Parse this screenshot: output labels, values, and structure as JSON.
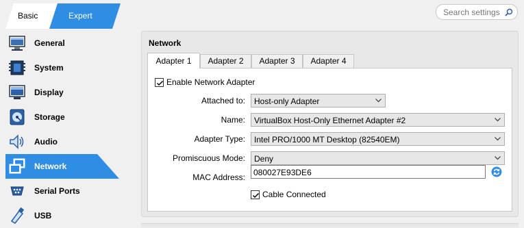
{
  "mode": {
    "basic_label": "Basic",
    "expert_label": "Expert",
    "selected": "Expert"
  },
  "search": {
    "placeholder": "Search settings",
    "icon": "search-icon"
  },
  "colors": {
    "accent": "#2f8de4",
    "accent_light": "#5aa5f0"
  },
  "sidebar": {
    "items": [
      {
        "label": "General",
        "icon": "monitor-icon"
      },
      {
        "label": "System",
        "icon": "chip-icon"
      },
      {
        "label": "Display",
        "icon": "display-icon"
      },
      {
        "label": "Storage",
        "icon": "disk-icon"
      },
      {
        "label": "Audio",
        "icon": "speaker-icon"
      },
      {
        "label": "Network",
        "icon": "network-icon",
        "active": true
      },
      {
        "label": "Serial Ports",
        "icon": "serial-port-icon"
      },
      {
        "label": "USB",
        "icon": "usb-icon"
      }
    ]
  },
  "panel": {
    "title": "Network",
    "tabs": [
      {
        "label": "Adapter 1",
        "active": true
      },
      {
        "label": "Adapter 2"
      },
      {
        "label": "Adapter 3"
      },
      {
        "label": "Adapter 4"
      }
    ],
    "enable_adapter": {
      "label": "Enable Network Adapter",
      "checked": true
    },
    "attached_to": {
      "label": "Attached to:",
      "value": "Host-only Adapter"
    },
    "name": {
      "label": "Name:",
      "value": "VirtualBox Host-Only Ethernet Adapter #2"
    },
    "adapter_type": {
      "label": "Adapter Type:",
      "value": "Intel PRO/1000 MT Desktop (82540EM)"
    },
    "promiscuous_mode": {
      "label": "Promiscuous Mode:",
      "value": "Deny"
    },
    "mac_address": {
      "label": "MAC Address:",
      "value": "080027E93DE6"
    },
    "cable_connected": {
      "label": "Cable Connected",
      "checked": true
    }
  }
}
